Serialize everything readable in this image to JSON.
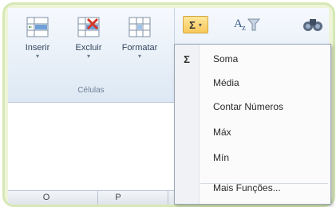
{
  "ribbon": {
    "cells_group": {
      "label": "Células",
      "buttons": [
        {
          "label": "Inserir",
          "arrow": "▾"
        },
        {
          "label": "Excluir",
          "arrow": "▾"
        },
        {
          "label": "Formatar",
          "arrow": "▾"
        }
      ]
    },
    "editing_group": {
      "autosum_symbol": "Σ",
      "autosum_arrow": "▾"
    }
  },
  "autosum_menu": {
    "items": [
      {
        "icon": "Σ",
        "label": "Soma"
      },
      {
        "icon": "",
        "label": "Média"
      },
      {
        "icon": "",
        "label": "Contar Números"
      },
      {
        "icon": "",
        "label": "Máx"
      },
      {
        "icon": "",
        "label": "Mín"
      },
      {
        "icon": "",
        "label": "Mais Funções..."
      }
    ]
  },
  "columns": [
    "O",
    "P"
  ],
  "colors": {
    "frame_border": "#d6e9b5",
    "autosum_highlight": "#f7c85a"
  }
}
